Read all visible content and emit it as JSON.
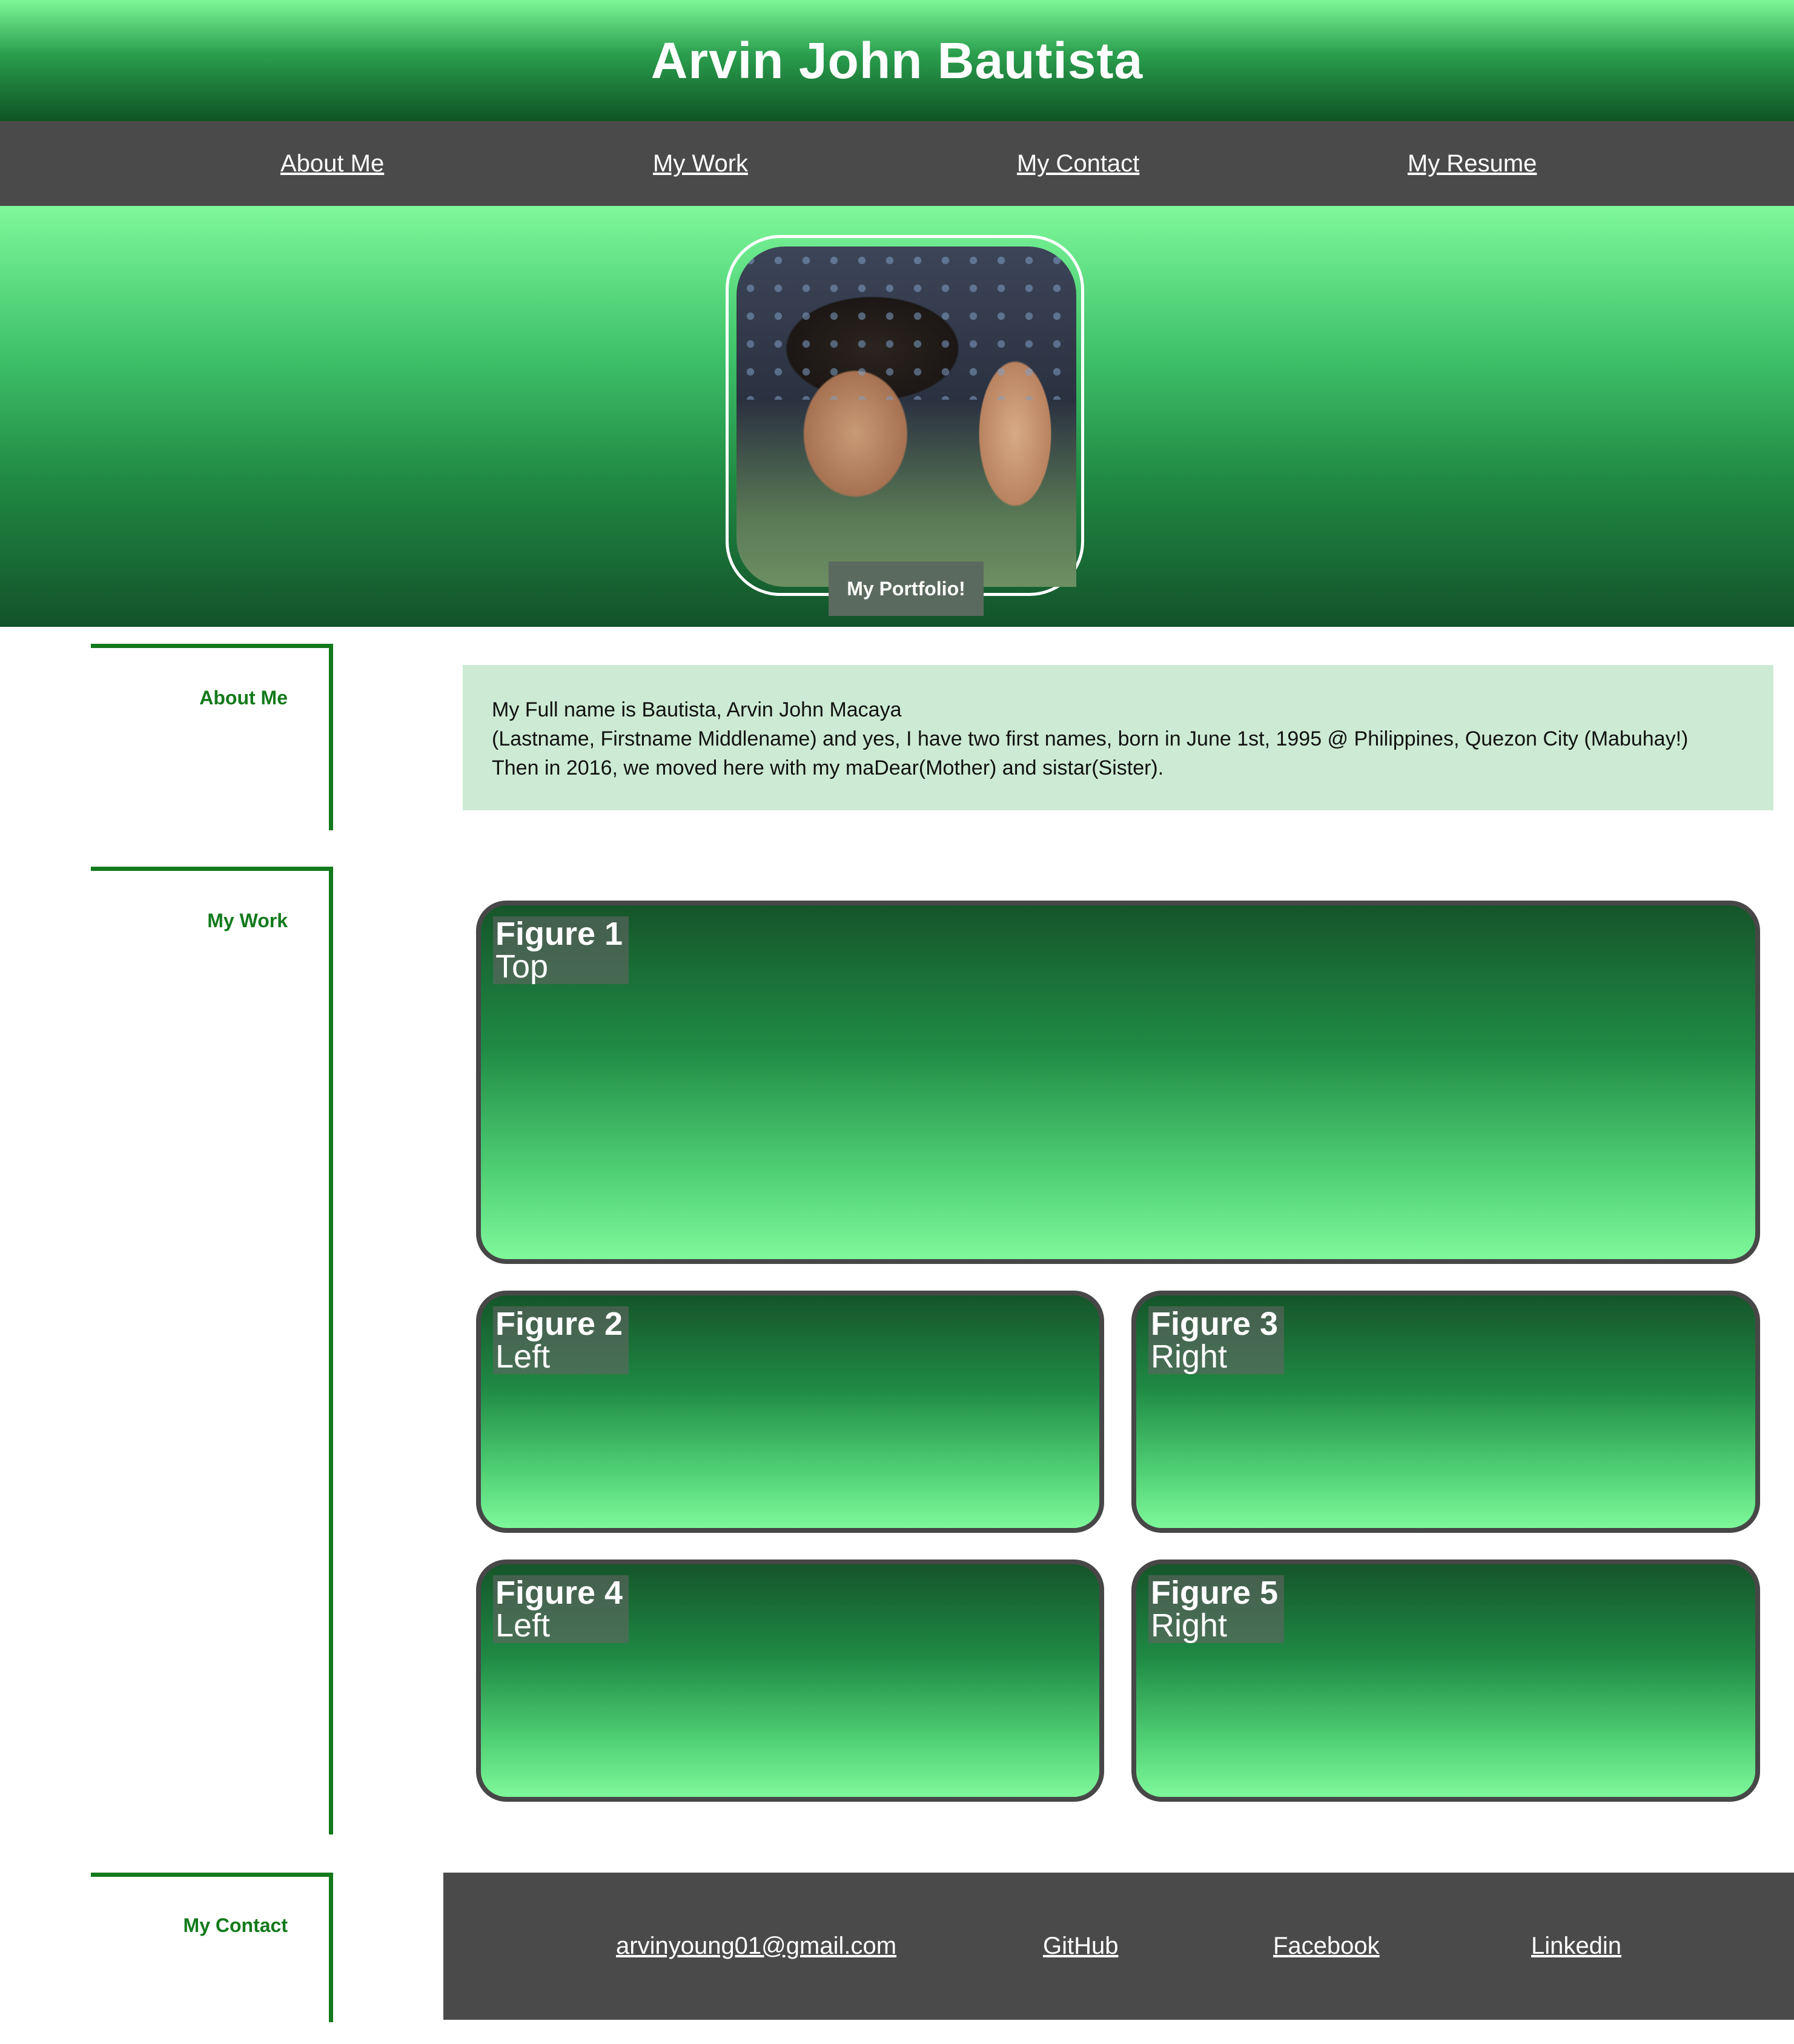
{
  "header": {
    "title": "Arvin John Bautista"
  },
  "nav": {
    "items": [
      {
        "label": "About Me"
      },
      {
        "label": "My Work"
      },
      {
        "label": "My Contact"
      },
      {
        "label": "My Resume"
      }
    ]
  },
  "hero": {
    "caption": "My Portfolio!"
  },
  "sections": {
    "about_label": "About Me",
    "work_label": "My Work",
    "contact_label": "My Contact"
  },
  "about": {
    "lines": [
      "My Full name is Bautista, Arvin John Macaya",
      "(Lastname, Firstname Middlename) and yes, I have two first names, born in June 1st, 1995 @ Philippines, Quezon City (Mabuhay!)",
      "Then in 2016, we moved here with my maDear(Mother) and sistar(Sister)."
    ]
  },
  "figures": [
    {
      "title": "Figure 1",
      "position": "Top"
    },
    {
      "title": "Figure 2",
      "position": "Left"
    },
    {
      "title": "Figure 3",
      "position": "Right"
    },
    {
      "title": "Figure 4",
      "position": "Left"
    },
    {
      "title": "Figure 5",
      "position": "Right"
    }
  ],
  "contact": {
    "email": "arvinyoung01@gmail.com",
    "github": "GitHub",
    "facebook": "Facebook",
    "linkedin": "Linkedin"
  },
  "colors": {
    "accent_green": "#137a1c",
    "nav_bg": "#4a4a4a",
    "about_bg": "#cdebd4"
  }
}
